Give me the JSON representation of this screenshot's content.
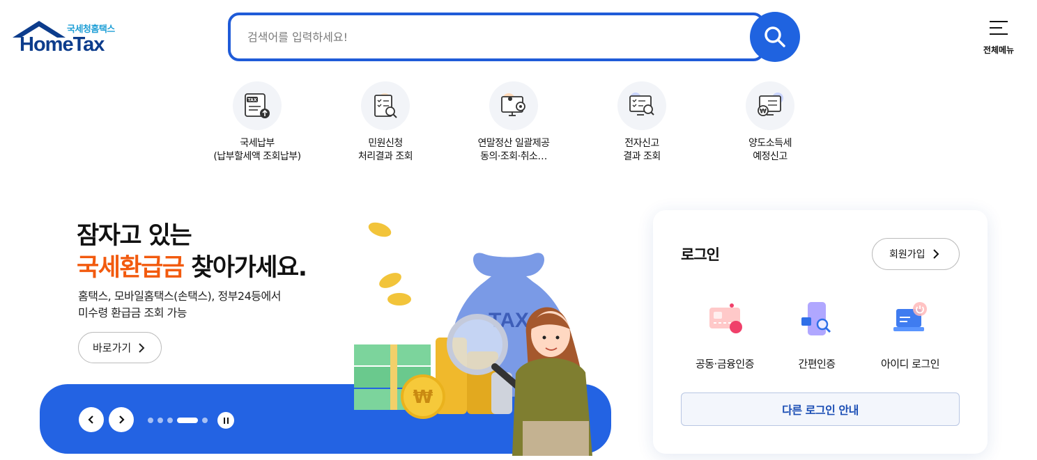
{
  "header": {
    "logo_sub": "국세청홈택스",
    "logo_main": "HomeTax",
    "search_placeholder": "검색어를 입력하세요!",
    "menu_label": "전체메뉴"
  },
  "quick_menu": [
    {
      "line1": "국세납부",
      "line2": "(납부할세액 조회납부)"
    },
    {
      "line1": "민원신청",
      "line2": "처리결과 조회"
    },
    {
      "line1": "연말정산 일괄제공",
      "line2": "동의·조회·취소…"
    },
    {
      "line1": "전자신고",
      "line2": "결과 조회"
    },
    {
      "line1": "양도소득세",
      "line2": "예정신고"
    }
  ],
  "banner": {
    "title_line1": "잠자고 있는",
    "title_highlight": "국세환급금",
    "title_rest": " 찾아가세요.",
    "desc_line1": "홈택스, 모바일홈택스(손택스), 정부24등에서",
    "desc_line2": "미수령 환급금 조회 가능",
    "button": "바로가기",
    "illustration_text": "TAX",
    "coin_symbol": "₩",
    "slide_count": 5,
    "active_slide": 4
  },
  "login": {
    "title": "로그인",
    "join_button": "회원가입",
    "methods": [
      {
        "label": "공동·금융인증",
        "icon": "certificate-card-icon"
      },
      {
        "label": "간편인증",
        "icon": "simple-auth-phone-icon"
      },
      {
        "label": "아이디 로그인",
        "icon": "id-login-laptop-icon"
      }
    ],
    "other_button": "다른 로그인 안내"
  },
  "colors": {
    "primary": "#1f63e0",
    "highlight": "#f25a0e",
    "logo": "#0c3c8c"
  }
}
